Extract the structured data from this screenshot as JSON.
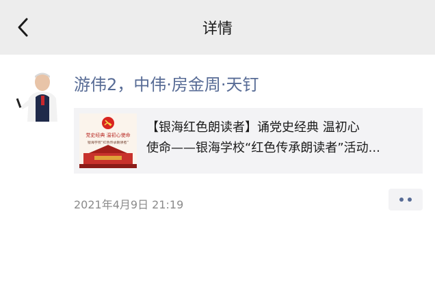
{
  "header": {
    "title": "详情",
    "back_icon": "chevron-left-icon"
  },
  "post": {
    "author_name": "游伟2，中伟·房金周·天钉",
    "timestamp": "2021年4月9日 21:19",
    "more_icon": "more-dots-icon"
  },
  "link_card": {
    "title_line1": "【银海红色朗读者】诵党史经典 温初心",
    "title_line2": "使命——银海学校“红色传承朗读者”活动...",
    "thumbnail_banner": "党史经典  温初心使命",
    "thumbnail_caption": "银海学校“红色传承朗读者”"
  },
  "colors": {
    "header_bg": "#ededed",
    "name_link": "#576b95",
    "card_bg": "#f3f3f5",
    "timestamp": "#8a8a8a"
  }
}
